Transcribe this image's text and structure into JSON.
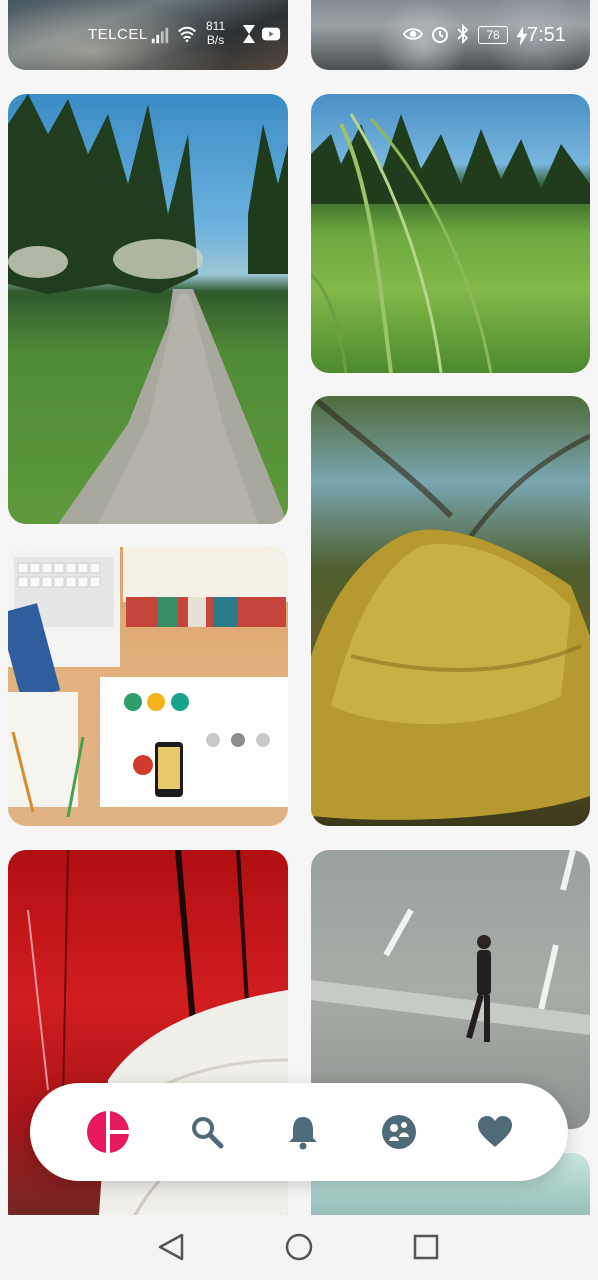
{
  "status_bar": {
    "carrier": "TELCEL",
    "speed_value": "811",
    "speed_unit": "B/s",
    "battery": "78",
    "time": "7:51"
  },
  "feed": {
    "photos": [
      {
        "name": "photo-top-left-partial",
        "subject": "rocks by water"
      },
      {
        "name": "photo-top-right-partial",
        "subject": "stones"
      },
      {
        "name": "photo-forest-path",
        "subject": "gravel path through forest"
      },
      {
        "name": "photo-grass",
        "subject": "tall grass close-up"
      },
      {
        "name": "photo-desk",
        "subject": "desk with laptop and books"
      },
      {
        "name": "photo-moss",
        "subject": "moss covered tree branch"
      },
      {
        "name": "photo-red-wall",
        "subject": "red wooden wall with books"
      },
      {
        "name": "photo-man-road",
        "subject": "man walking on road"
      },
      {
        "name": "photo-bottom-right-partial",
        "subject": "blurred sky"
      }
    ]
  },
  "tab_bar": {
    "tabs": [
      {
        "name": "home-tab",
        "icon": "home-circle-icon",
        "active": true
      },
      {
        "name": "search-tab",
        "icon": "search-icon",
        "active": false
      },
      {
        "name": "notifications-tab",
        "icon": "bell-icon",
        "active": false
      },
      {
        "name": "community-tab",
        "icon": "community-icon",
        "active": false
      },
      {
        "name": "favorites-tab",
        "icon": "heart-icon",
        "active": false
      }
    ],
    "active_color": "#e6195f",
    "inactive_color": "#4f6a78"
  },
  "nav_bar": {
    "buttons": [
      {
        "name": "back-button",
        "icon": "back-triangle-icon"
      },
      {
        "name": "home-button",
        "icon": "home-circle-outline-icon"
      },
      {
        "name": "recents-button",
        "icon": "recents-square-icon"
      }
    ]
  }
}
